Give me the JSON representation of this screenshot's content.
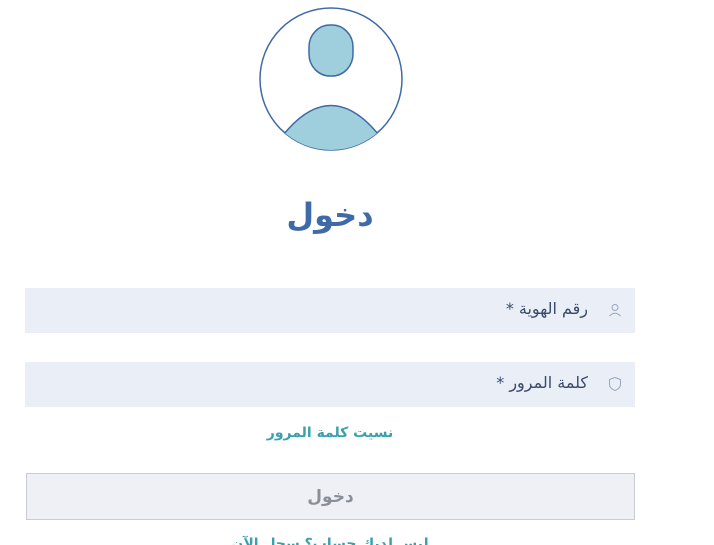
{
  "avatar": {
    "icon": "user-avatar-icon"
  },
  "title": "دخول",
  "fields": {
    "id_number": {
      "label": "رقم الهوية *",
      "value": "",
      "icon": "user-icon"
    },
    "password": {
      "label": "كلمة المرور *",
      "value": "",
      "icon": "shield-icon"
    }
  },
  "forgot_password": "نسيت كلمة المرور",
  "login_button": "دخول",
  "bottom_link": "ليس لديك حساب؟ سجل الآن",
  "colors": {
    "primary": "#3f6aa8",
    "avatar_fill": "#9fcfdc",
    "field_bg": "#e9eef7",
    "link": "#3aa0ad",
    "button_bg": "#eef0f6"
  }
}
